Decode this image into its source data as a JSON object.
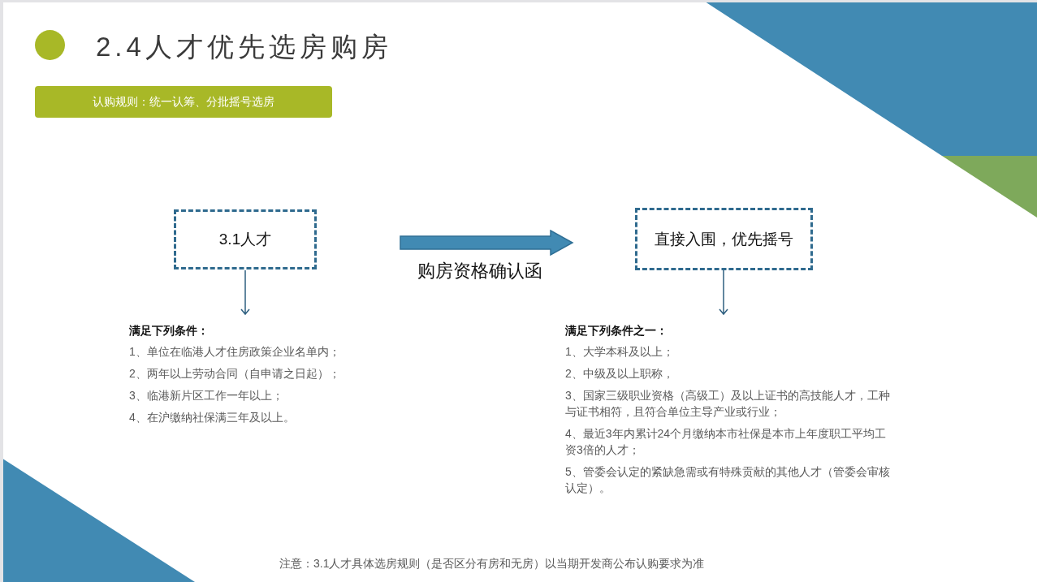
{
  "title": "2.4人才优先选房购房",
  "rule_banner": "认购规则：统一认筹、分批摇号选房",
  "flow": {
    "source": "3.1人才",
    "arrow_label": "购房资格确认函",
    "target": "直接入围，优先摇号"
  },
  "left_conditions": {
    "heading": "满足下列条件：",
    "items": [
      "1、单位在临港人才住房政策企业名单内；",
      "2、两年以上劳动合同（自申请之日起）；",
      "3、临港新片区工作一年以上；",
      "4、在沪缴纳社保满三年及以上。"
    ]
  },
  "right_conditions": {
    "heading": "满足下列条件之一：",
    "items": [
      "1、大学本科及以上；",
      "2、中级及以上职称，",
      "3、国家三级职业资格（高级工）及以上证书的高技能人才，工种与证书相符，且符合单位主导产业或行业；",
      "4、最近3年内累计24个月缴纳本市社保是本市上年度职工平均工资3倍的人才；",
      "5、管委会认定的紧缺急需或有特殊贡献的其他人才（管委会审核认定）。"
    ]
  },
  "note": "注意：3.1人才具体选房规则（是否区分有房和无房）以当期开发商公布认购要求为准"
}
